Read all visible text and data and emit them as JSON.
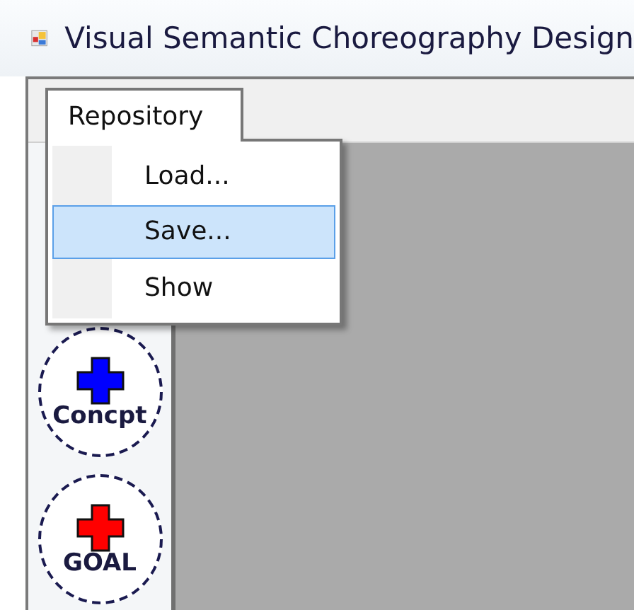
{
  "window": {
    "title": "Visual Semantic Choreography Design"
  },
  "menu_bar": [
    {
      "label": "Repository",
      "expanded": true
    }
  ],
  "dropdown": [
    {
      "label": "Load...",
      "selected": false
    },
    {
      "label": "Save...",
      "selected": true
    },
    {
      "label": "Show",
      "selected": false
    }
  ],
  "toolbox": [
    {
      "label": "Concpt",
      "color": "#0000ff"
    },
    {
      "label": "GOAL",
      "color": "#ff0000"
    }
  ]
}
